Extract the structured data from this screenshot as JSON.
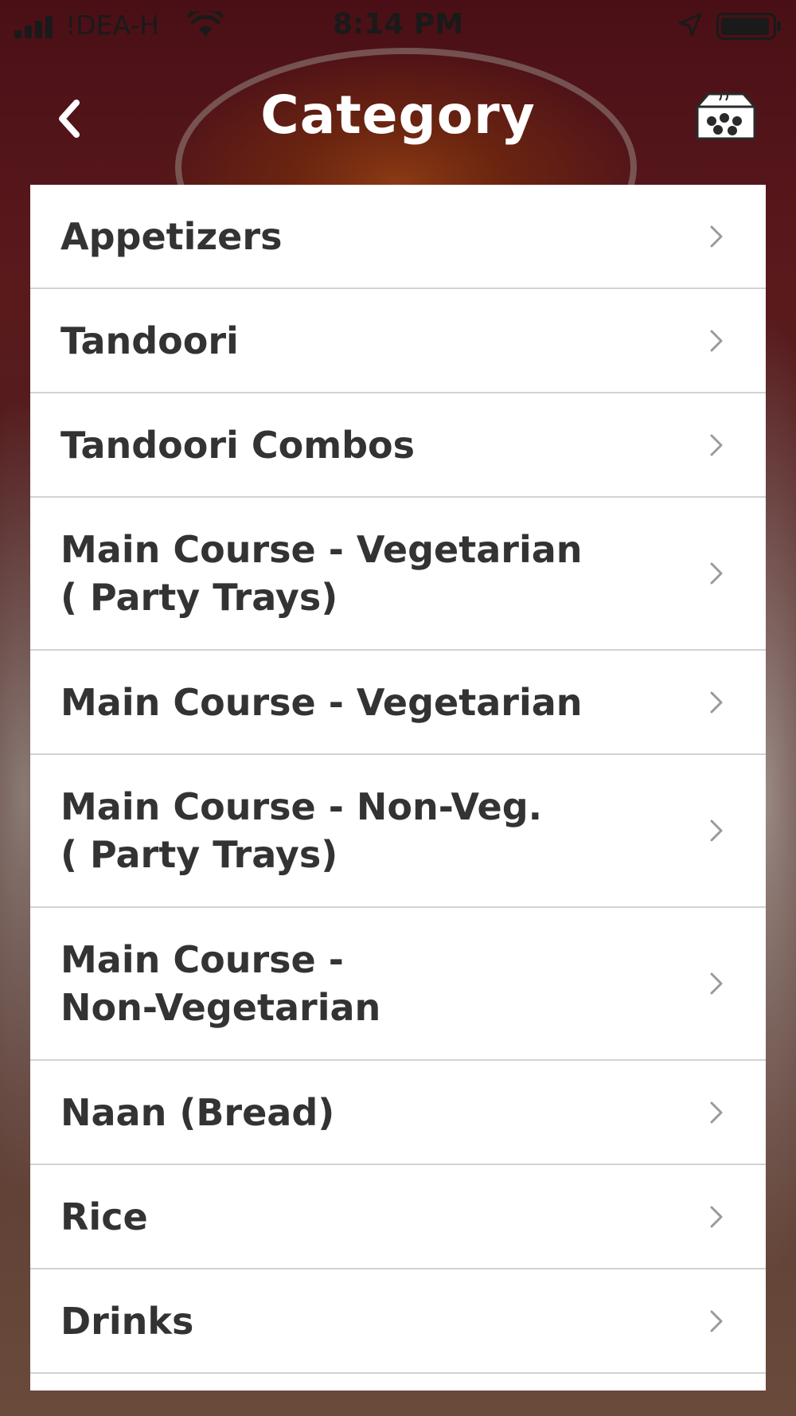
{
  "status_bar": {
    "carrier": "!DEA-H",
    "time": "8:14 PM",
    "icons": [
      "signal-icon",
      "wifi-icon",
      "location-arrow-icon",
      "battery-icon"
    ]
  },
  "nav": {
    "title": "Category",
    "back_icon": "chevron-left-icon",
    "cart_icon": "food-box-icon"
  },
  "colors": {
    "title_text": "#ffffff",
    "list_background": "#ffffff",
    "item_text": "#333333",
    "divider": "#d2d2d2",
    "chevron": "#9a9a9a"
  },
  "categories": [
    {
      "label": "Appetizers",
      "lines": 1
    },
    {
      "label": "Tandoori",
      "lines": 1
    },
    {
      "label": "Tandoori Combos",
      "lines": 1
    },
    {
      "label": "Main Course - Vegetarian\n( Party Trays)",
      "lines": 2
    },
    {
      "label": "Main Course - Vegetarian",
      "lines": 1
    },
    {
      "label": "Main Course - Non-Veg.\n( Party Trays)",
      "lines": 2
    },
    {
      "label": "Main Course -\nNon-Vegetarian",
      "lines": 2
    },
    {
      "label": "Naan (Bread)",
      "lines": 1
    },
    {
      "label": "Rice",
      "lines": 1
    },
    {
      "label": "Drinks",
      "lines": 1
    }
  ]
}
